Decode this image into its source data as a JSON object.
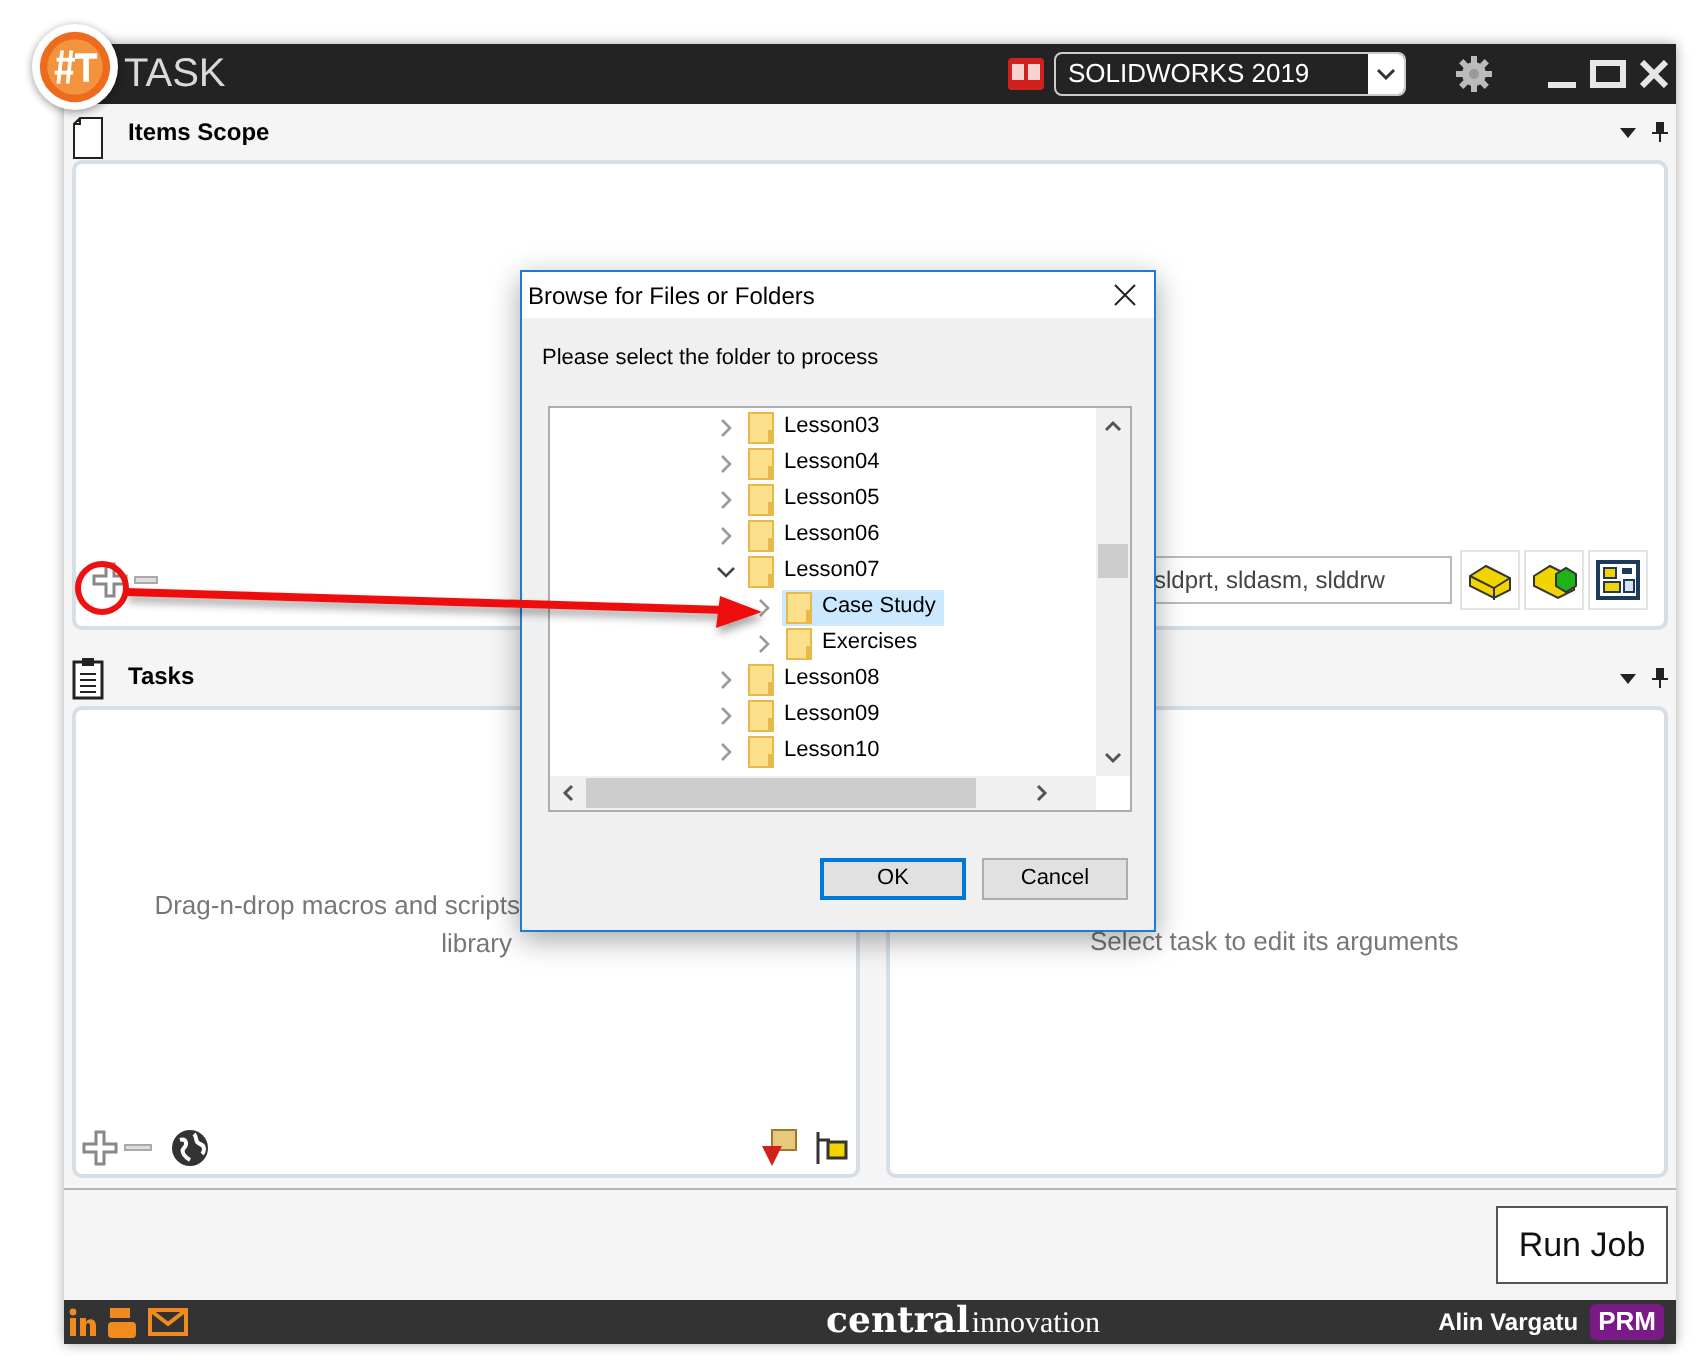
{
  "app": {
    "title": "TASK",
    "version_select": "SOLIDWORKS 2019"
  },
  "items_scope": {
    "title": "Items Scope",
    "filter": "sldprt, sldasm, slddrw"
  },
  "tasks": {
    "title": "Tasks",
    "hint_lines": [
      "Drag-n-drop macros and scripts",
      "library"
    ]
  },
  "arguments": {
    "hint": "Select task to edit its arguments"
  },
  "run_button": "Run Job",
  "footer": {
    "brand_bold": "central",
    "brand_light": "innovation",
    "user": "Alin Vargatu",
    "badge": "PRM"
  },
  "dialog": {
    "title": "Browse for Files or Folders",
    "prompt": "Please select the folder to process",
    "tree": [
      {
        "label": "Lesson03",
        "expanded": false,
        "selected": false
      },
      {
        "label": "Lesson04",
        "expanded": false,
        "selected": false
      },
      {
        "label": "Lesson05",
        "expanded": false,
        "selected": false
      },
      {
        "label": "Lesson06",
        "expanded": false,
        "selected": false
      },
      {
        "label": "Lesson07",
        "expanded": true,
        "selected": false,
        "children": [
          {
            "label": "Case Study",
            "expanded": false,
            "selected": true
          },
          {
            "label": "Exercises",
            "expanded": false,
            "selected": false
          }
        ]
      },
      {
        "label": "Lesson08",
        "expanded": false,
        "selected": false
      },
      {
        "label": "Lesson09",
        "expanded": false,
        "selected": false
      },
      {
        "label": "Lesson10",
        "expanded": false,
        "selected": false
      }
    ],
    "buttons": [
      {
        "label": "OK",
        "default": true
      },
      {
        "label": "Cancel",
        "default": false
      }
    ]
  }
}
